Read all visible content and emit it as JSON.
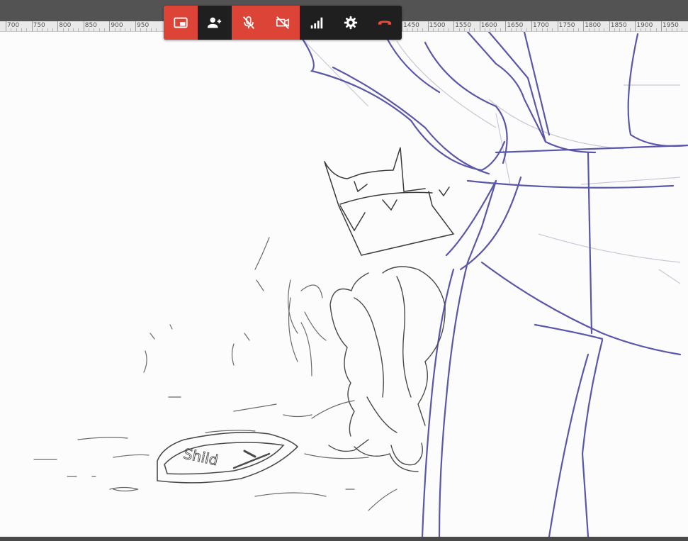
{
  "ruler": {
    "labels": [
      "700",
      "750",
      "800",
      "850",
      "900",
      "950",
      "1450",
      "1500",
      "1550",
      "1600",
      "1650",
      "1700",
      "1750",
      "1800",
      "1850",
      "1900",
      "1950"
    ]
  },
  "call_toolbar": {
    "buttons": [
      {
        "name": "picture-in-picture-button",
        "icon": "picture-in-picture-icon",
        "active_color": "#db4437"
      },
      {
        "name": "add-person-button",
        "icon": "person-add-icon"
      },
      {
        "name": "microphone-off-button",
        "icon": "microphone-off-icon",
        "active_color": "#db4437"
      },
      {
        "name": "camera-off-button",
        "icon": "video-off-icon",
        "active_color": "#db4437"
      },
      {
        "name": "connection-signal-button",
        "icon": "signal-bars-icon"
      },
      {
        "name": "settings-button",
        "icon": "gear-icon"
      },
      {
        "name": "hang-up-button",
        "icon": "phone-hangup-icon",
        "icon_color": "#e54b3c"
      }
    ]
  },
  "canvas": {
    "sketch_text": "Shild"
  },
  "colors": {
    "toolbar_bg": "#1f1f1f",
    "toolbar_red": "#db4437",
    "sketch_blue": "#5a57a8",
    "sketch_gray": "#4a4a4a"
  }
}
